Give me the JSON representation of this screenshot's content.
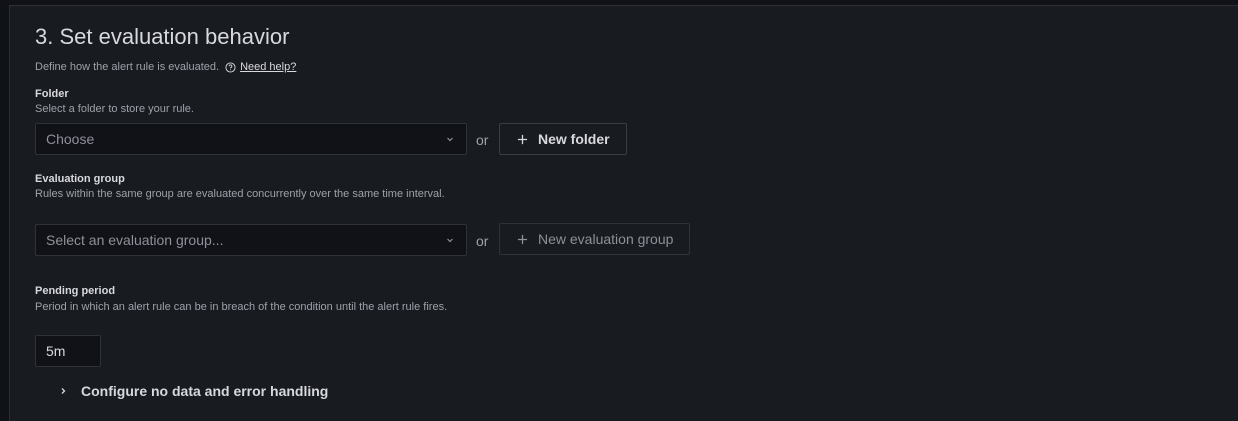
{
  "section": {
    "title": "3. Set evaluation behavior",
    "description": "Define how the alert rule is evaluated.",
    "help_link": "Need help?"
  },
  "folder": {
    "label": "Folder",
    "description": "Select a folder to store your rule.",
    "placeholder": "Choose",
    "or": "or",
    "new_button": "New folder"
  },
  "evaluation_group": {
    "label": "Evaluation group",
    "description": "Rules within the same group are evaluated concurrently over the same time interval.",
    "placeholder": "Select an evaluation group...",
    "or": "or",
    "new_button": "New evaluation group"
  },
  "pending_period": {
    "label": "Pending period",
    "description": "Period in which an alert rule can be in breach of the condition until the alert rule fires.",
    "value": "5m"
  },
  "no_data_toggle": {
    "label": "Configure no data and error handling"
  },
  "icons": {
    "help": "help-circle-icon",
    "chevron_down": "chevron-down-icon",
    "plus": "plus-icon",
    "chevron_right": "chevron-right-icon"
  },
  "colors": {
    "background": "#111217",
    "panel": "#181b1f",
    "text_primary": "#d8d9e0",
    "text_secondary": "#9fa1ab",
    "border": "#2f3238"
  }
}
